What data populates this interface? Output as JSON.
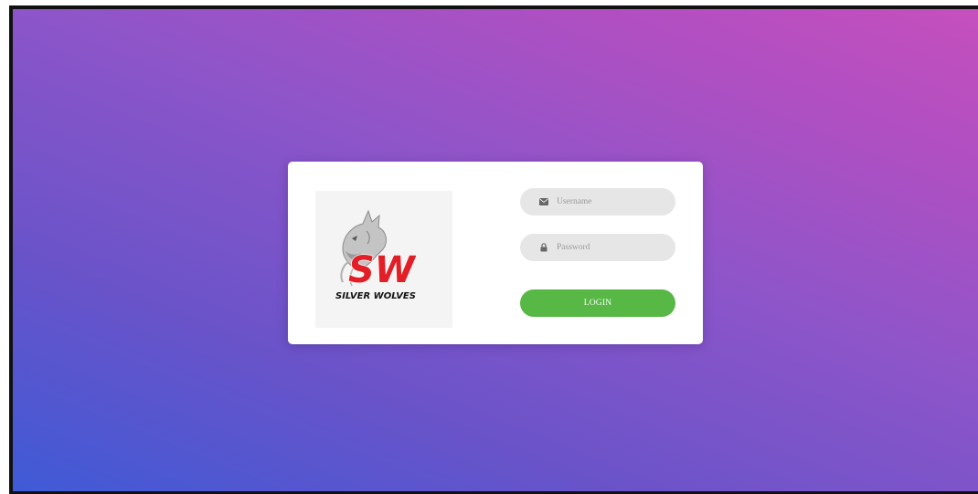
{
  "login_form": {
    "username_placeholder": "Username",
    "password_placeholder": "Password",
    "login_label": "LOGIN"
  },
  "logo": {
    "monogram": "SW",
    "name": "SILVER WOLVES"
  },
  "icons": {
    "username": "envelope-icon",
    "password": "lock-icon"
  },
  "colors": {
    "gradient_start": "#3f5ad6",
    "gradient_mid": "#8f55c9",
    "gradient_end": "#c64fbd",
    "card": "#ffffff",
    "field_background": "#e6e6e6",
    "login_button": "#57b846",
    "logo_red": "#e21e26"
  }
}
